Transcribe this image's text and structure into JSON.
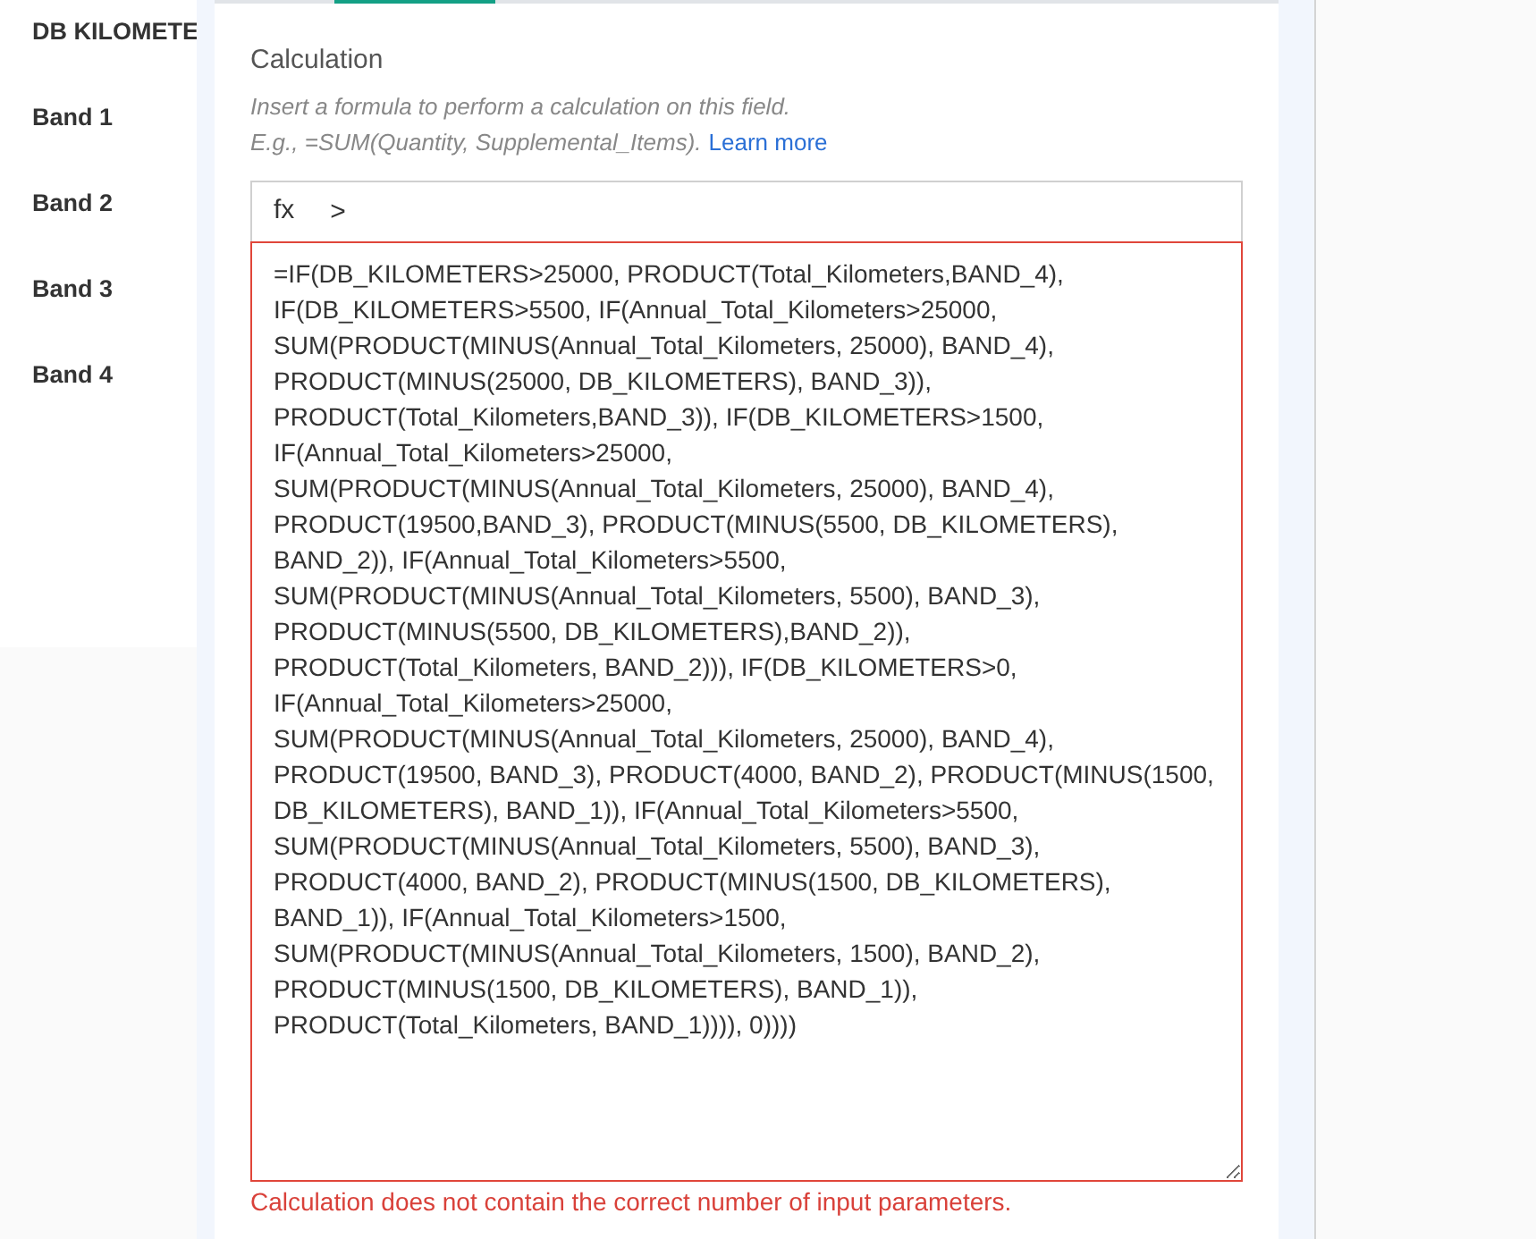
{
  "field_labels": [
    "DB KILOMETE",
    "Band 1",
    "Band 2",
    "Band 3",
    "Band 4"
  ],
  "panel": {
    "title": "Calculation",
    "hint": "Insert a formula to perform a calculation on this field.",
    "example": "E.g., =SUM(Quantity, Supplemental_Items).",
    "link": "Learn more",
    "formula_bar": {
      "label": "fx",
      "expand": ">"
    },
    "formula_lines": [
      "=IF(DB_KILOMETERS>25000, PRODUCT(Total_Kilometers,BAND_4),",
      "IF(DB_KILOMETERS>5500, IF(Annual_Total_Kilometers>25000,",
      "SUM(PRODUCT(MINUS(Annual_Total_Kilometers, 25000), BAND_4),",
      "PRODUCT(MINUS(25000, DB_KILOMETERS), BAND_3)),",
      "PRODUCT(Total_Kilometers,BAND_3)), IF(DB_KILOMETERS>1500,",
      "IF(Annual_Total_Kilometers>25000,",
      "SUM(PRODUCT(MINUS(Annual_Total_Kilometers, 25000), BAND_4),",
      "PRODUCT(19500,BAND_3), PRODUCT(MINUS(5500, DB_KILOMETERS),",
      "BAND_2)), IF(Annual_Total_Kilometers>5500,",
      "SUM(PRODUCT(MINUS(Annual_Total_Kilometers, 5500), BAND_3),",
      "PRODUCT(MINUS(5500, DB_KILOMETERS),BAND_2)),",
      "PRODUCT(Total_Kilometers, BAND_2))), IF(DB_KILOMETERS>0,",
      "IF(Annual_Total_Kilometers>25000,",
      "SUM(PRODUCT(MINUS(Annual_Total_Kilometers, 25000), BAND_4),",
      "PRODUCT(19500, BAND_3), PRODUCT(4000, BAND_2), PRODUCT(MINUS(1500,",
      "DB_KILOMETERS), BAND_1)), IF(Annual_Total_Kilometers>5500,",
      "SUM(PRODUCT(MINUS(Annual_Total_Kilometers, 5500), BAND_3),",
      "PRODUCT(4000, BAND_2), PRODUCT(MINUS(1500, DB_KILOMETERS),",
      "BAND_1)), IF(Annual_Total_Kilometers>1500,",
      "SUM(PRODUCT(MINUS(Annual_Total_Kilometers, 1500), BAND_2),",
      "PRODUCT(MINUS(1500, DB_KILOMETERS), BAND_1)),",
      "PRODUCT(Total_Kilometers, BAND_1)))), 0))))"
    ],
    "invalid": true,
    "error": "Calculation does not contain the correct number of input parameters."
  }
}
